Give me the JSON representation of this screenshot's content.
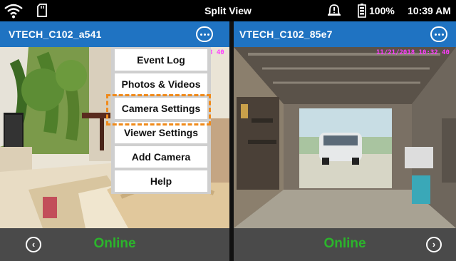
{
  "status_bar": {
    "title": "Split View",
    "battery": "100%",
    "time": "10:39 AM",
    "icons": [
      "wifi-icon",
      "sd-card-icon",
      "notification-bell-icon",
      "battery-icon"
    ]
  },
  "cameras": [
    {
      "name": "VTECH_C102_a541",
      "status": "Online",
      "timestamp_fragment": "3 40"
    },
    {
      "name": "VTECH_C102_85e7",
      "status": "Online",
      "timestamp": "11/21/2018 10:32 40"
    }
  ],
  "menu": {
    "items": [
      "Event Log",
      "Photos & Videos",
      "Camera Settings",
      "Viewer Settings",
      "Add Camera",
      "Help"
    ],
    "highlighted": "Camera Settings"
  },
  "navigation": {
    "prev_icon": "chevron-left-icon",
    "next_icon": "chevron-right-icon"
  },
  "colors": {
    "header": "#1f73c2",
    "online": "#2bb52b",
    "highlight": "#f08a1a",
    "footer": "#4a4a4a"
  }
}
